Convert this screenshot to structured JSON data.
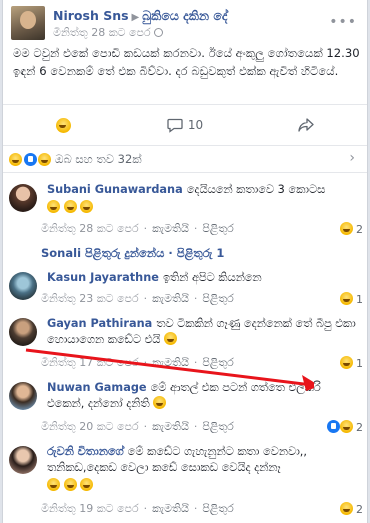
{
  "post": {
    "author": "Nirosh Sns",
    "group": "බුකියෙ දකින දේ",
    "time": "මිනිත්තු 28 කට පෙර",
    "body": "මම ටවුන් එකේ පොඩි කඩයක් කරනවා. ඊයේ අංකුලු ගෝතයෙක් 12.30 ඉඳන් 6 වෙනකම් තේ එක බිව්වා. දර බඩුවකුත් එක්ක ඇවිත් හිටියේ.",
    "comment_count": "10"
  },
  "reactions_summary": "ඔබ සහ තව 32ක්",
  "labels": {
    "like": "කැමතියි",
    "reply": "පිළිතුර"
  },
  "comments": [
    {
      "name": "Subani Gunawardana",
      "text": "දෙයියනේ කතාවෙ 3 කොටස",
      "time": "මිනිත්තු 28 කට පෙර",
      "count": "2"
    },
    {
      "name": "Kasun Jayarathne",
      "text": "ඉතින් අපිට කියන්නෙ",
      "time": "මිනිත්තු 23 කට පෙර",
      "count": "1"
    },
    {
      "name": "Gayan Pathirana",
      "text": "තව ටිකකින් ගෑණු දෙන්නෙක් තේ බීපු එකා හොයාගෙන කඩේට එයි",
      "time": "මිනිත්තු 17 කට පෙර",
      "count": "1"
    },
    {
      "name": "Nuwan Gamage",
      "text": "මේ ආතල් එක පටන් ගත්තෙ එලකිරි එකෙන්, දන්නෝ දනිති",
      "time": "මිනිත්තු 20 කට පෙර",
      "count": "2"
    },
    {
      "name": "රුවනි විතානගේ",
      "text": "මේ කඩේට ගැහැනුන්ට කතා වෙනවා,, තනිකඩ,දෙකඩ වෙලා කඩේ සොකඩ වෙයිද දන්නෑ",
      "time": "මිනිත්තු 19 කට පෙර",
      "count": "2"
    }
  ],
  "replies_header": {
    "author": "Sonali පිළිතුරු දුන්නේය",
    "count_label": "පිළිතුරු 1"
  }
}
